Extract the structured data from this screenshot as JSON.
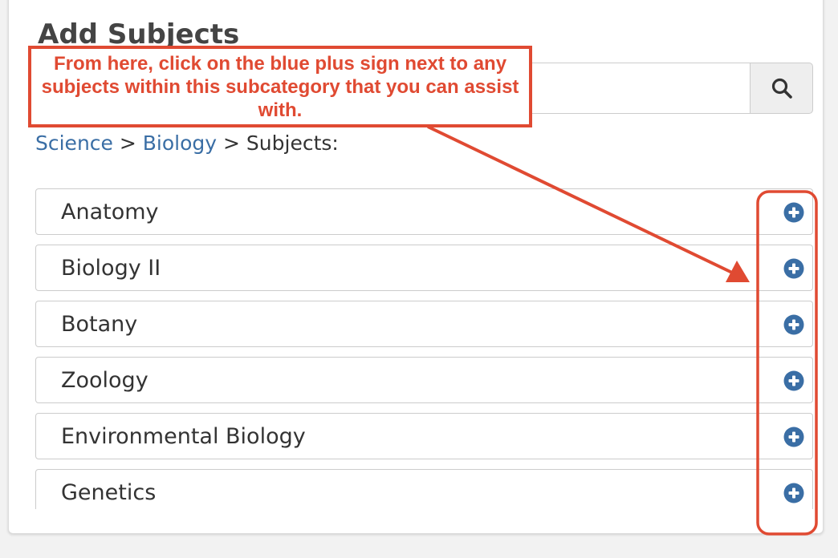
{
  "panel": {
    "title": "Add Subjects"
  },
  "search": {
    "value": "",
    "placeholder": "",
    "button_icon": "search-icon"
  },
  "breadcrumb": {
    "level1": "Science",
    "sep1": " > ",
    "level2": "Biology",
    "sep2": " > ",
    "current": "Subjects:"
  },
  "subjects": [
    {
      "label": "Anatomy",
      "action_icon": "plus-circle-icon"
    },
    {
      "label": "Biology II",
      "action_icon": "plus-circle-icon"
    },
    {
      "label": "Botany",
      "action_icon": "plus-circle-icon"
    },
    {
      "label": "Zoology",
      "action_icon": "plus-circle-icon"
    },
    {
      "label": "Environmental Biology",
      "action_icon": "plus-circle-icon"
    },
    {
      "label": "Genetics",
      "action_icon": "plus-circle-icon"
    }
  ],
  "annotation": {
    "text": "From here, click on the blue plus sign next to any subjects within this subcategory that you can assist with.",
    "color": "#e04a32"
  },
  "colors": {
    "link": "#3a6ea5",
    "plus_icon": "#3a6ea5",
    "annotation": "#e04a32"
  }
}
